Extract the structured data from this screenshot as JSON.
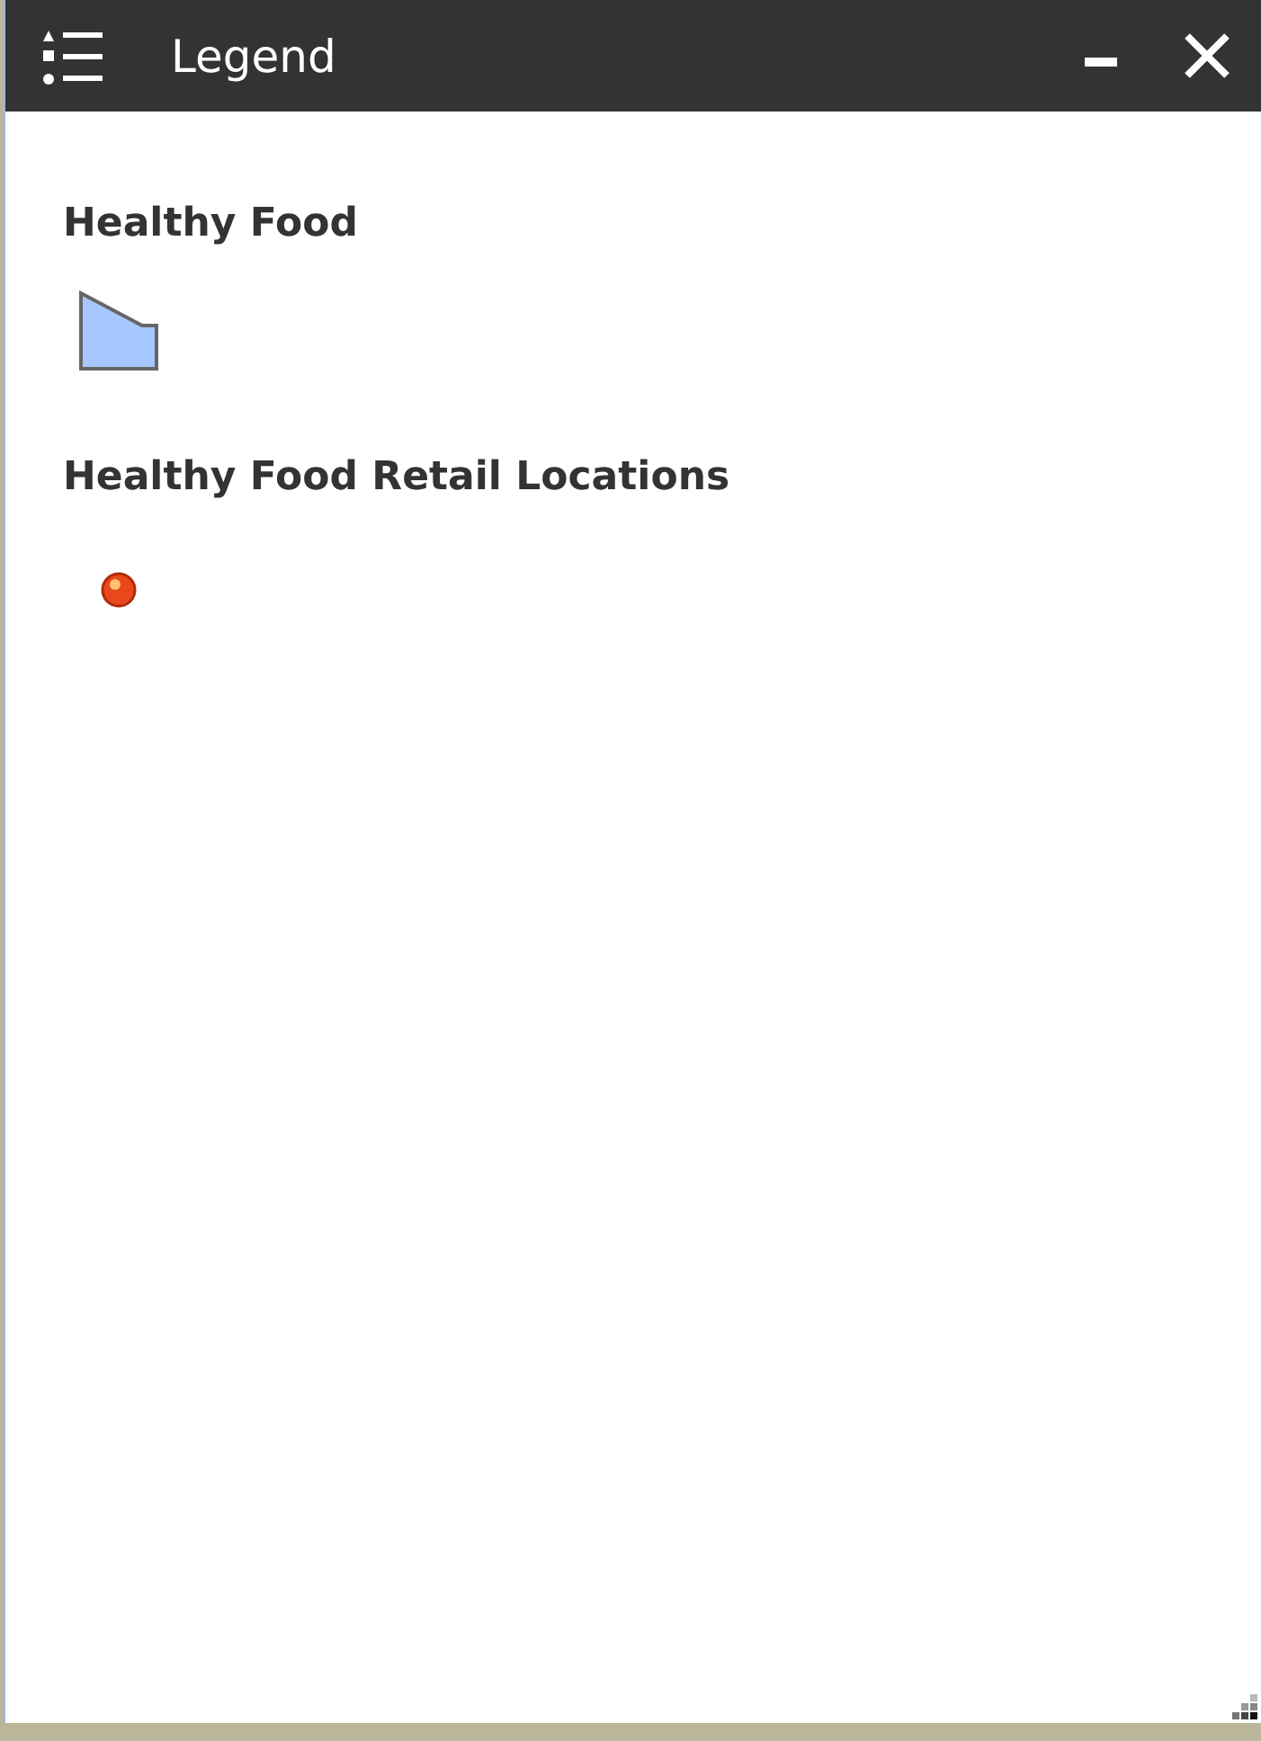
{
  "window": {
    "title": "Legend"
  },
  "layers": [
    {
      "title": "Healthy Food",
      "symbol": {
        "kind": "polygon",
        "color": "#a6c8ff"
      }
    },
    {
      "title": "Healthy Food Retail Locations",
      "symbol": {
        "kind": "point",
        "color": "#e8481c"
      }
    }
  ]
}
